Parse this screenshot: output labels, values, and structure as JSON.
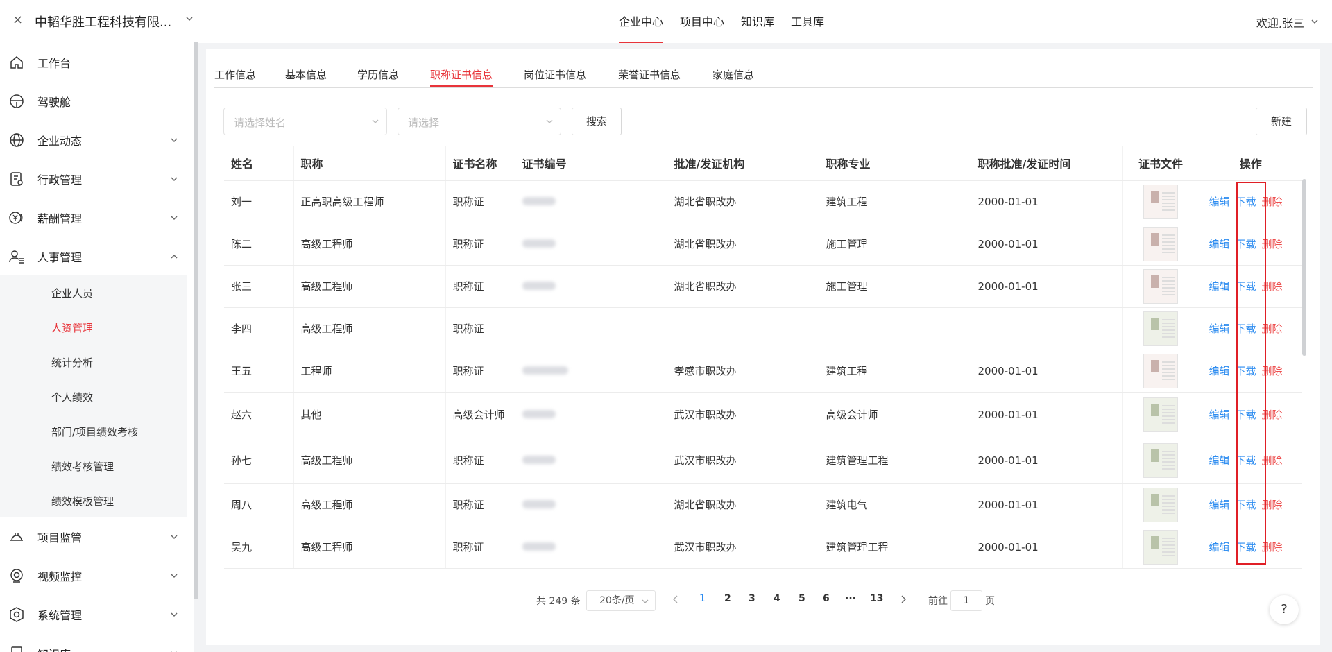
{
  "header": {
    "close_glyph": "×",
    "company": "中韬华胜工程科技有限...",
    "nav": [
      "企业中心",
      "项目中心",
      "知识库",
      "工具库"
    ],
    "welcome": "欢迎,张三"
  },
  "sidebar": {
    "items": [
      {
        "label": "工作台",
        "icon": "home-icon"
      },
      {
        "label": "驾驶舱",
        "icon": "steering-wheel-icon"
      },
      {
        "label": "企业动态",
        "icon": "globe-icon"
      },
      {
        "label": "行政管理",
        "icon": "admin-doc-icon"
      },
      {
        "label": "薪酬管理",
        "icon": "yen-coin-icon"
      },
      {
        "label": "人事管理",
        "icon": "user-list-icon"
      },
      {
        "label": "项目监管",
        "icon": "helmet-icon"
      },
      {
        "label": "视频监控",
        "icon": "camera-icon"
      },
      {
        "label": "系统管理",
        "icon": "settings-hex-icon"
      },
      {
        "label": "知识库",
        "icon": "book-icon"
      }
    ],
    "sub_items": [
      "企业人员",
      "人资管理",
      "统计分析",
      "个人绩效",
      "部门/项目绩效考核",
      "绩效考核管理",
      "绩效模板管理"
    ]
  },
  "tabs": [
    "工作信息",
    "基本信息",
    "学历信息",
    "职称证书信息",
    "岗位证书信息",
    "荣誉证书信息",
    "家庭信息"
  ],
  "filters": {
    "name_placeholder": "请选择姓名",
    "select_placeholder": "请选择",
    "search_label": "搜索",
    "new_label": "新建"
  },
  "table": {
    "headers": [
      "姓名",
      "职称",
      "证书名称",
      "证书编号",
      "批准/发证机构",
      "职称专业",
      "职称批准/发证时间",
      "证书文件",
      "操作"
    ],
    "op_labels": {
      "edit": "编辑",
      "download": "下载",
      "delete": "删除"
    },
    "rows": [
      {
        "name": "刘一",
        "title": "正高职高级工程师",
        "cert": "职称证",
        "org": "湖北省职改办",
        "major": "建筑工程",
        "date": "2000-01-01"
      },
      {
        "name": "陈二",
        "title": "高级工程师",
        "cert": "职称证",
        "org": "湖北省职改办",
        "major": "施工管理",
        "date": "2000-01-01"
      },
      {
        "name": "张三",
        "title": "高级工程师",
        "cert": "职称证",
        "org": "湖北省职改办",
        "major": "施工管理",
        "date": "2000-01-01"
      },
      {
        "name": "李四",
        "title": "高级工程师",
        "cert": "职称证",
        "org": "",
        "major": "",
        "date": ""
      },
      {
        "name": "王五",
        "title": "工程师",
        "cert": "职称证",
        "org": "孝感市职改办",
        "major": "建筑工程",
        "date": "2000-01-01"
      },
      {
        "name": "赵六",
        "title": "其他",
        "cert": "高级会计师",
        "org": "武汉市职改办",
        "major": "高级会计师",
        "date": "2000-01-01"
      },
      {
        "name": "孙七",
        "title": "高级工程师",
        "cert": "职称证",
        "org": "武汉市职改办",
        "major": "建筑管理工程",
        "date": "2000-01-01"
      },
      {
        "name": "周八",
        "title": "高级工程师",
        "cert": "职称证",
        "org": "湖北省职改办",
        "major": "建筑电气",
        "date": "2000-01-01"
      },
      {
        "name": "吴九",
        "title": "高级工程师",
        "cert": "职称证",
        "org": "武汉市职改办",
        "major": "建筑管理工程",
        "date": "2000-01-01"
      }
    ]
  },
  "pagination": {
    "total": "共 249 条",
    "page_size": "20条/页",
    "pages": [
      "1",
      "2",
      "3",
      "4",
      "5",
      "6",
      "···",
      "13"
    ],
    "current": "1",
    "goto_prefix": "前往",
    "goto_value": "1",
    "goto_suffix": "页"
  },
  "help": "?"
}
